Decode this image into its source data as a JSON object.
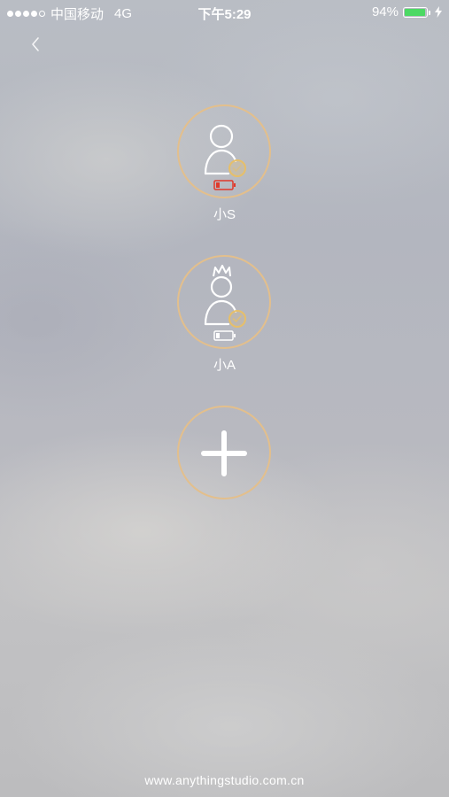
{
  "status_bar": {
    "carrier": "中国移动",
    "network": "4G",
    "time": "下午5:29",
    "battery_percent": "94%",
    "battery_level": 0.94,
    "battery_color": "#4cd964",
    "signal_strength": 4,
    "signal_max": 5
  },
  "nav": {
    "back_icon": "chevron-left-icon"
  },
  "profiles": [
    {
      "name": "小S",
      "avatar_icon": "person-icon",
      "status_icon": "check-circle-icon",
      "battery_icon": "battery-low-icon",
      "battery_color": "#e0392b"
    },
    {
      "name": "小A",
      "avatar_icon": "person-with-crown-icon",
      "status_icon": "check-circle-icon",
      "battery_icon": "battery-low-icon",
      "battery_color": "#ffffff"
    }
  ],
  "add_button": {
    "icon": "plus-icon"
  },
  "footer": {
    "url": "www.anythingstudio.com.cn"
  },
  "colors": {
    "ring": "#e3bf8c",
    "check": "#e6bf6a"
  }
}
